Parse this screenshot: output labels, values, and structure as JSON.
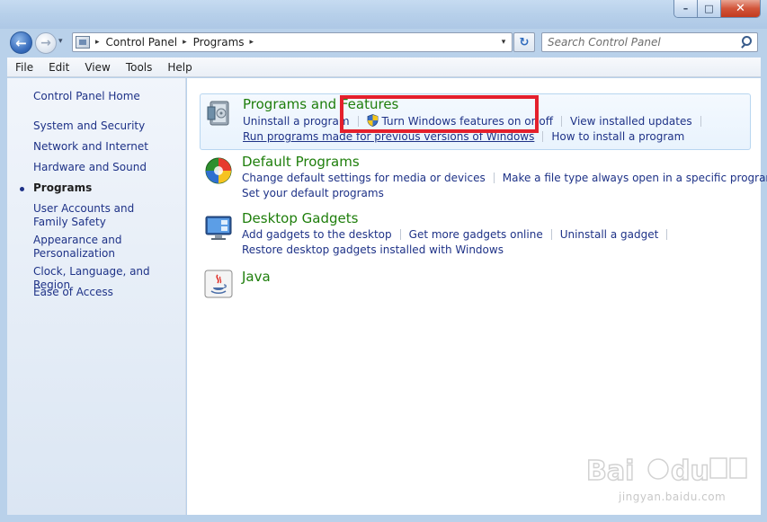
{
  "window": {
    "controls": {
      "minimize": "–",
      "maximize": "□",
      "close": "✕"
    }
  },
  "nav": {
    "back_glyph": "←",
    "forward_glyph": "→",
    "history_glyph": "▾",
    "breadcrumbs": [
      "Control Panel",
      "Programs"
    ],
    "crumb_separator": "▸",
    "dropdown_glyph": "▾",
    "refresh_glyph": "↻",
    "search_placeholder": "Search Control Panel"
  },
  "menu": [
    "File",
    "Edit",
    "View",
    "Tools",
    "Help"
  ],
  "sidebar": {
    "home": "Control Panel Home",
    "items": [
      {
        "label": "System and Security"
      },
      {
        "label": "Network and Internet"
      },
      {
        "label": "Hardware and Sound"
      },
      {
        "label": "Programs",
        "active": true
      },
      {
        "label": "User Accounts and Family Safety"
      },
      {
        "label": "Appearance and Personalization"
      },
      {
        "label": "Clock, Language, and Region"
      },
      {
        "label": "Ease of Access"
      }
    ]
  },
  "groups": [
    {
      "title": "Programs and Features",
      "icon": "programs-features-icon",
      "links_row1": [
        "Uninstall a program",
        "Turn Windows features on or off",
        "View installed updates"
      ],
      "links_row2": [
        "Run programs made for previous versions of Windows",
        "How to install a program"
      ]
    },
    {
      "title": "Default Programs",
      "icon": "default-programs-icon",
      "links_row1": [
        "Change default settings for media or devices",
        "Make a file type always open in a specific program"
      ],
      "links_row2": [
        "Set your default programs"
      ]
    },
    {
      "title": "Desktop Gadgets",
      "icon": "desktop-gadgets-icon",
      "links_row1": [
        "Add gadgets to the desktop",
        "Get more gadgets online",
        "Uninstall a gadget"
      ],
      "links_row2": [
        "Restore desktop gadgets installed with Windows"
      ]
    },
    {
      "title": "Java",
      "icon": "java-icon"
    }
  ],
  "colors": {
    "link": "#1e3287",
    "group_title": "#1e7e0b",
    "highlight_box": "#e4202c"
  },
  "watermark": {
    "text": "jingyan.baidu.com"
  }
}
